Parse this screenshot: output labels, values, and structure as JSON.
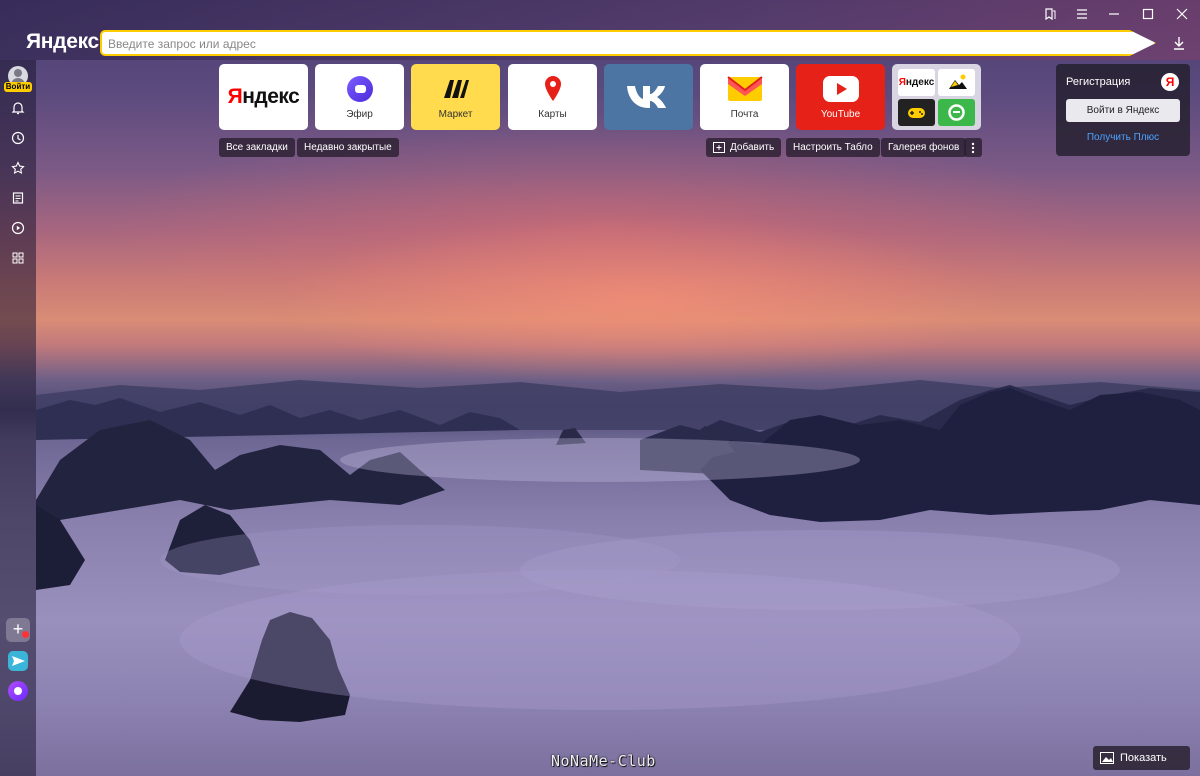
{
  "window": {
    "brand": "Яндекс",
    "address_placeholder": "Введите запрос или адрес"
  },
  "sidebar": {
    "login_label": "Войти"
  },
  "tiles": [
    {
      "label": "",
      "logo": "Яндекс"
    },
    {
      "label": "Эфир"
    },
    {
      "label": "Маркет"
    },
    {
      "label": "Карты"
    },
    {
      "label": ""
    },
    {
      "label": "Почта"
    },
    {
      "label": "YouTube"
    },
    {
      "label": "",
      "mini_logo": "Яндекс"
    }
  ],
  "pills": {
    "all_bookmarks": "Все закладки",
    "recently_closed": "Недавно закрытые",
    "add": "Добавить",
    "customize": "Настроить Табло",
    "gallery": "Галерея фонов"
  },
  "account_panel": {
    "title": "Регистрация",
    "ya_letter": "Я",
    "login_button": "Войти в Яндекс",
    "plus_link": "Получить Плюс"
  },
  "show_background": "Показать фон",
  "watermark": "NoNaMe-Club",
  "colors": {
    "address_border": "#ffcc00",
    "market_yellow": "#ffdb4d",
    "vk_blue": "#4c75a3",
    "youtube_red": "#e62117",
    "link_blue": "#4aa3ff"
  }
}
